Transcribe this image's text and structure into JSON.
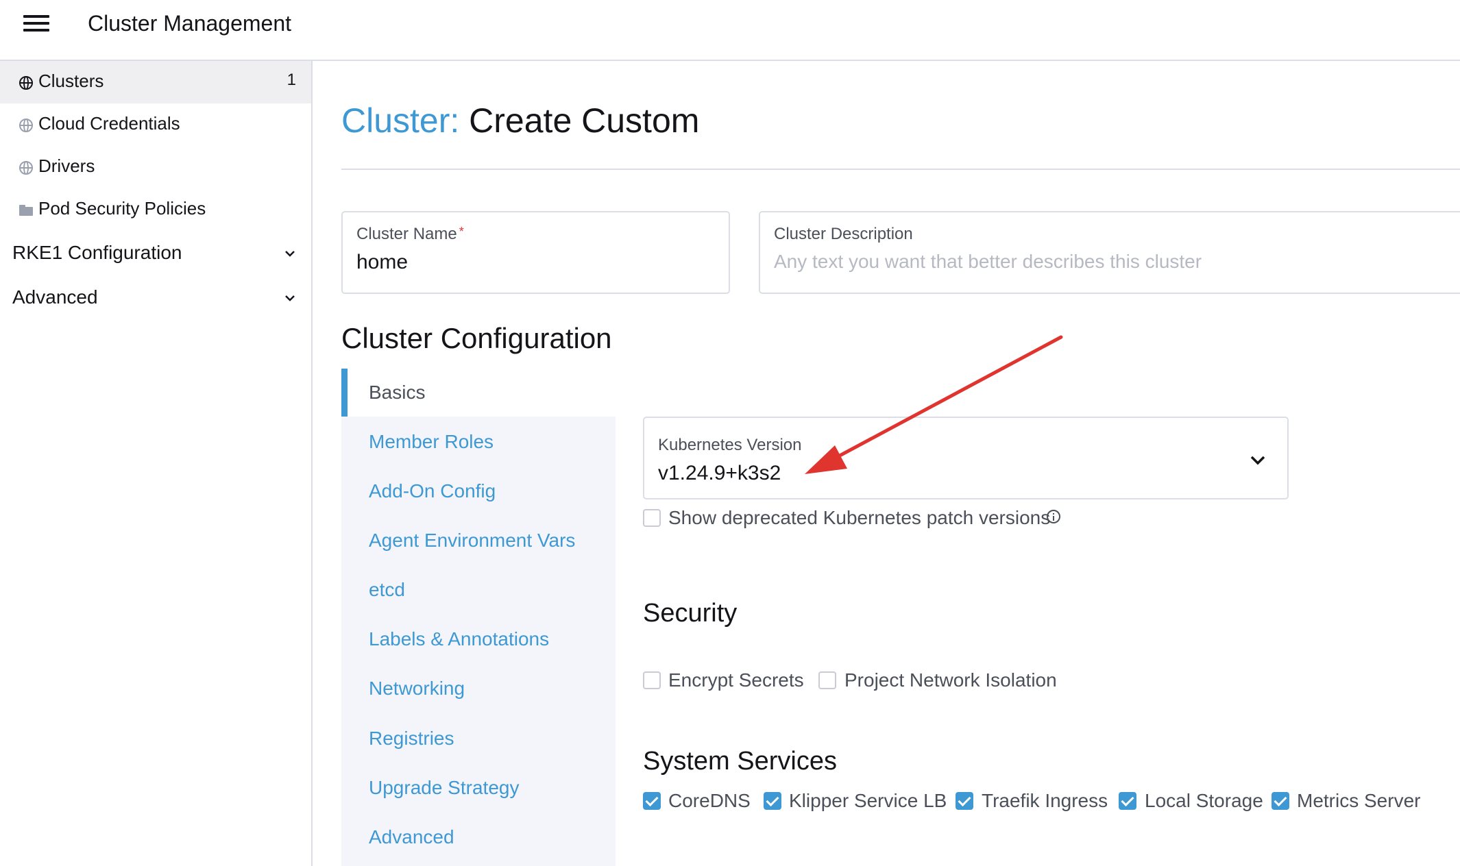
{
  "header": {
    "title": "Cluster Management"
  },
  "sidebar": {
    "items": [
      {
        "label": "Clusters",
        "count": "1",
        "icon": "globe-icon"
      },
      {
        "label": "Cloud Credentials",
        "icon": "globe-icon"
      },
      {
        "label": "Drivers",
        "icon": "globe-icon"
      },
      {
        "label": "Pod Security Policies",
        "icon": "folder-icon"
      }
    ],
    "groups": [
      {
        "label": "RKE1 Configuration",
        "icon": "chevron-down-icon"
      },
      {
        "label": "Advanced",
        "icon": "chevron-down-icon"
      }
    ]
  },
  "main": {
    "title_prefix": "Cluster:",
    "title": "Create Custom",
    "cluster_name": {
      "label": "Cluster Name",
      "required_marker": "*",
      "value": "home"
    },
    "cluster_description": {
      "label": "Cluster Description",
      "placeholder": "Any text you want that better describes this cluster"
    },
    "config_title": "Cluster Configuration",
    "tabs": [
      {
        "label": "Basics",
        "active": true
      },
      {
        "label": "Member Roles"
      },
      {
        "label": "Add-On Config"
      },
      {
        "label": "Agent Environment Vars"
      },
      {
        "label": "etcd"
      },
      {
        "label": "Labels & Annotations"
      },
      {
        "label": "Networking"
      },
      {
        "label": "Registries"
      },
      {
        "label": "Upgrade Strategy"
      },
      {
        "label": "Advanced"
      }
    ],
    "kubernetes_version": {
      "label": "Kubernetes Version",
      "value": "v1.24.9+k3s2"
    },
    "show_deprecated": {
      "label": "Show deprecated Kubernetes patch versions",
      "checked": false
    },
    "security": {
      "title": "Security",
      "options": [
        {
          "label": "Encrypt Secrets",
          "checked": false
        },
        {
          "label": "Project Network Isolation",
          "checked": false
        }
      ]
    },
    "system_services": {
      "title": "System Services",
      "options": [
        {
          "label": "CoreDNS",
          "checked": true
        },
        {
          "label": "Klipper Service LB",
          "checked": true
        },
        {
          "label": "Traefik Ingress",
          "checked": true
        },
        {
          "label": "Local Storage",
          "checked": true
        },
        {
          "label": "Metrics Server",
          "checked": true
        }
      ]
    }
  },
  "colors": {
    "accent": "#3d98d3",
    "annotation_arrow": "#e0342f",
    "tab_panel_bg": "#f4f5fa"
  }
}
